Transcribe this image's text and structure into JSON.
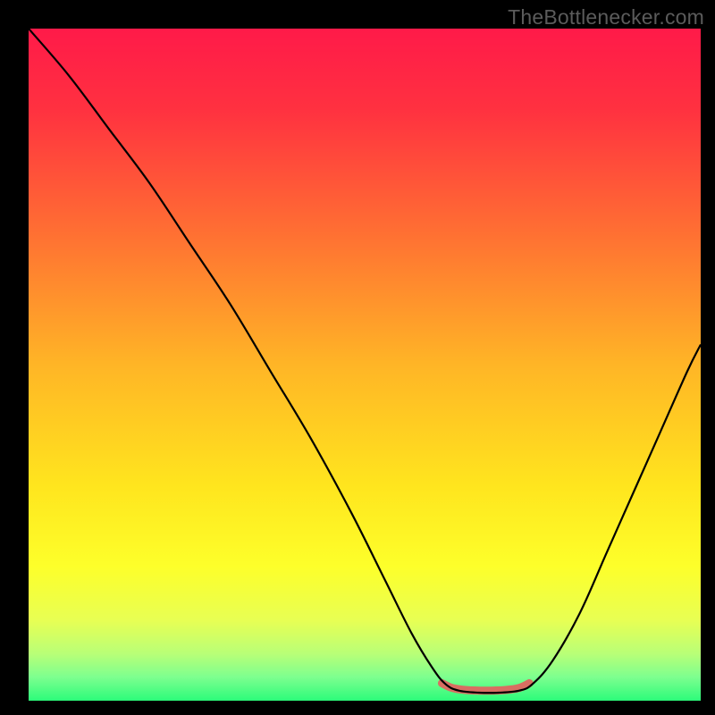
{
  "watermark": "TheBottlenecker.com",
  "chart_data": {
    "type": "line",
    "title": "",
    "xlabel": "",
    "ylabel": "",
    "xlim": [
      0,
      100
    ],
    "ylim": [
      0,
      100
    ],
    "grid": false,
    "legend": false,
    "gradient_stops": [
      {
        "offset": 0,
        "color": "#ff1a49"
      },
      {
        "offset": 0.12,
        "color": "#ff3140"
      },
      {
        "offset": 0.3,
        "color": "#ff6e33"
      },
      {
        "offset": 0.5,
        "color": "#ffb526"
      },
      {
        "offset": 0.68,
        "color": "#ffe51e"
      },
      {
        "offset": 0.8,
        "color": "#fdff2a"
      },
      {
        "offset": 0.88,
        "color": "#e8ff53"
      },
      {
        "offset": 0.93,
        "color": "#b9ff77"
      },
      {
        "offset": 0.965,
        "color": "#7dff8f"
      },
      {
        "offset": 1.0,
        "color": "#2cfb7a"
      }
    ],
    "series": [
      {
        "name": "bottleneck-curve",
        "stroke": "#000000",
        "stroke_width": 2.2,
        "points": [
          {
            "x": 0,
            "y": 100
          },
          {
            "x": 6,
            "y": 93
          },
          {
            "x": 12,
            "y": 85
          },
          {
            "x": 18,
            "y": 77
          },
          {
            "x": 24,
            "y": 68
          },
          {
            "x": 30,
            "y": 59
          },
          {
            "x": 36,
            "y": 49
          },
          {
            "x": 42,
            "y": 39
          },
          {
            "x": 48,
            "y": 28
          },
          {
            "x": 53,
            "y": 18
          },
          {
            "x": 57,
            "y": 10
          },
          {
            "x": 60,
            "y": 5
          },
          {
            "x": 62,
            "y": 2.5
          },
          {
            "x": 64,
            "y": 1.5
          },
          {
            "x": 67,
            "y": 1.2
          },
          {
            "x": 70,
            "y": 1.2
          },
          {
            "x": 73,
            "y": 1.5
          },
          {
            "x": 75,
            "y": 2.5
          },
          {
            "x": 78,
            "y": 6
          },
          {
            "x": 82,
            "y": 13
          },
          {
            "x": 86,
            "y": 22
          },
          {
            "x": 90,
            "y": 31
          },
          {
            "x": 94,
            "y": 40
          },
          {
            "x": 98,
            "y": 49
          },
          {
            "x": 100,
            "y": 53
          }
        ]
      },
      {
        "name": "flat-highlight",
        "stroke": "#d86e62",
        "stroke_width": 9,
        "linecap": "round",
        "points": [
          {
            "x": 61.5,
            "y": 2.6
          },
          {
            "x": 63,
            "y": 1.9
          },
          {
            "x": 65,
            "y": 1.6
          },
          {
            "x": 68,
            "y": 1.5
          },
          {
            "x": 71,
            "y": 1.6
          },
          {
            "x": 73,
            "y": 1.9
          },
          {
            "x": 74.5,
            "y": 2.6
          }
        ]
      }
    ]
  }
}
